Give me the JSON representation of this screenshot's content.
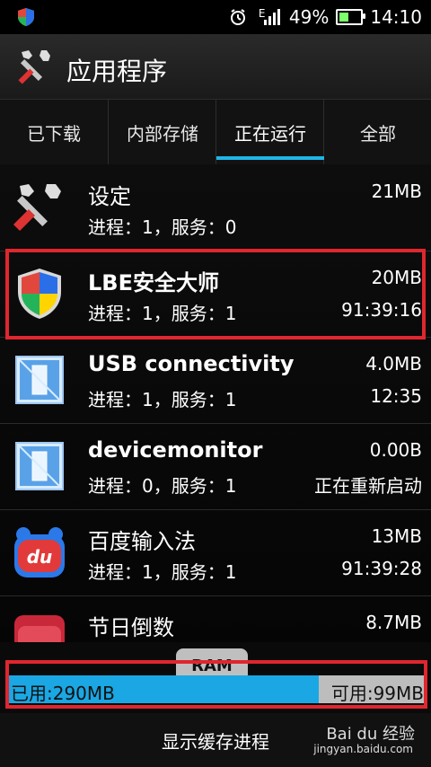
{
  "status_bar": {
    "signal_letter": "E",
    "battery_percent": "49%",
    "time": "14:10",
    "colors": {
      "battery_fill": "#7cff6b"
    }
  },
  "header": {
    "title": "应用程序",
    "icon": "tools-icon"
  },
  "tabs": [
    {
      "label": "已下载"
    },
    {
      "label": "内部存储"
    },
    {
      "label": "正在运行",
      "active": true
    },
    {
      "label": "全部"
    }
  ],
  "apps": [
    {
      "name": "设定",
      "meta": "进程：1，服务：0",
      "size": "21MB",
      "time": "",
      "icon": "settings-tools-icon"
    },
    {
      "name": "LBE安全大师",
      "meta": "进程：1，服务：1",
      "size": "20MB",
      "time": "91:39:16",
      "icon": "shield-icon"
    },
    {
      "name": "USB connectivity",
      "meta": "进程：1，服务：1",
      "size": "4.0MB",
      "time": "12:35",
      "icon": "android-app-icon"
    },
    {
      "name": "devicemonitor",
      "meta": "进程：0，服务：1",
      "size": "0.00B",
      "time": "正在重新启动",
      "icon": "android-app-icon"
    },
    {
      "name": "百度输入法",
      "meta": "进程：1，服务：1",
      "size": "13MB",
      "time": "91:39:28",
      "icon": "baidu-ime-icon"
    },
    {
      "name": "节日倒数",
      "meta": "",
      "size": "8.7MB",
      "time": "",
      "icon": "calendar-icon"
    }
  ],
  "ram": {
    "label": "RAM",
    "used_label": "已用:290MB",
    "free_label": "可用:99MB",
    "used_fraction": 0.745
  },
  "bottom": {
    "button_label": "显示缓存进程"
  },
  "watermark": {
    "text": "Bai du 经验",
    "sub": "jingyan.baidu.com"
  },
  "colors": {
    "accent": "#1fb6e6",
    "highlight": "#e0262e"
  }
}
